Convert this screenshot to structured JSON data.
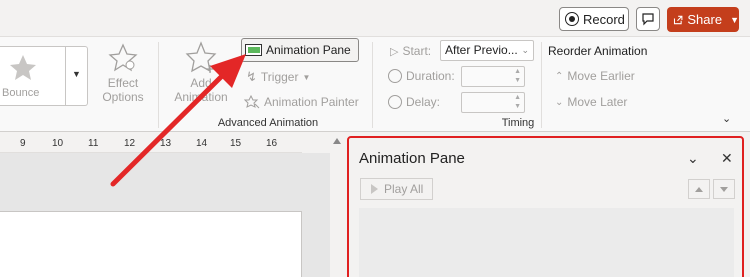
{
  "titlebar": {
    "record_label": "Record",
    "share_label": "Share"
  },
  "ribbon": {
    "animations_gallery": {
      "selected_label": "Bounce"
    },
    "effect_options": {
      "line1": "Effect",
      "line2": "Options"
    },
    "add_animation": {
      "line1": "Add",
      "line2": "Animation"
    },
    "advanced_animation": {
      "group_label": "Advanced Animation",
      "animation_pane_label": "Animation Pane",
      "trigger_label": "Trigger",
      "animation_painter_label": "Animation Painter"
    },
    "timing": {
      "group_label": "Timing",
      "start_label": "Start:",
      "start_value": "After Previo...",
      "duration_label": "Duration:",
      "duration_value": "",
      "delay_label": "Delay:",
      "delay_value": "",
      "reorder_title": "Reorder Animation",
      "move_earlier_label": "Move Earlier",
      "move_later_label": "Move Later"
    }
  },
  "ruler": {
    "ticks": [
      "9",
      "10",
      "11",
      "12",
      "13",
      "14",
      "15",
      "16"
    ]
  },
  "animation_pane": {
    "title": "Animation Pane",
    "play_all_label": "Play All"
  },
  "colors": {
    "share_button": "#c43e1c",
    "highlight_border": "#e02020",
    "arrow": "#e32727"
  }
}
